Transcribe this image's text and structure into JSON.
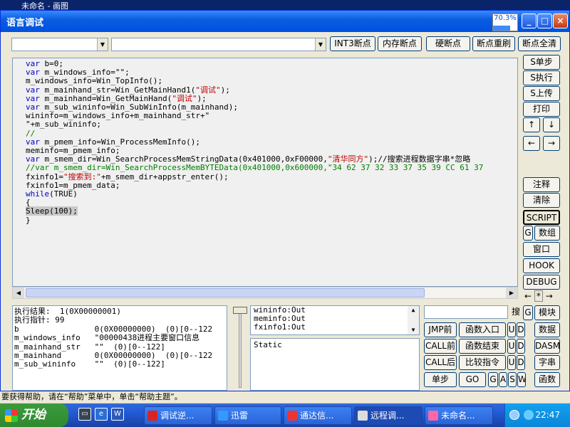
{
  "behind_window": {
    "title": "未命名 - 画图",
    "status_text": "要获得帮助，请在“帮助”菜单中，单击“帮助主题”。"
  },
  "window": {
    "title": "语言调试",
    "progress_text": "70.3%",
    "progress_value": 0.703
  },
  "toolbar": {
    "combo1_value": "",
    "combo2_value": "",
    "int3": "INT3断点",
    "mem": "内存断点",
    "hw": "硬断点",
    "reset": "断点重刷",
    "clear": "断点全清"
  },
  "code": {
    "lines": [
      {
        "t": "var b=0;",
        "k": "var"
      },
      {
        "t": "var m_windows_info=\"\";",
        "k": "var"
      },
      {
        "t": "m_windows_info=Win_TopInfo();"
      },
      {
        "t": "var m_mainhand_str=Win_GetMainHand1(\"调试\");",
        "k": "var"
      },
      {
        "t": "var m_mainhand=Win_GetMainHand(\"调试\");",
        "k": "var"
      },
      {
        "t": "var m_sub_wininfo=Win_SubWinInfo(m_mainhand);",
        "k": "var"
      },
      {
        "t": "wininfo=m_windows_info+m_mainhand_str+\""
      },
      {
        "t": "\"+m_sub_wininfo;"
      },
      {
        "t": "//",
        "c": true
      },
      {
        "t": "var m_pmem_info=Win_ProcessMemInfo();",
        "k": "var"
      },
      {
        "t": "meminfo=m_pmem_info;"
      },
      {
        "t": "var m_smem_dir=Win_SearchProcessMemStringData(0x401000,0xF00000,\"清华同方\");//搜索进程数据字串*忽略",
        "k": "var"
      },
      {
        "t": "//var m_smem_dir=Win_SearchProcessMemBYTEData(0x401000,0x600000,\"34 62 37 32 33 37 35 39 CC 61 37",
        "c": true
      },
      {
        "t": "fxinfo1=\"搜索到:\"+m_smem_dir+appstr_enter();"
      },
      {
        "t": "fxinfo1=m_pmem_data;"
      },
      {
        "t": "while(TRUE)",
        "k": "while"
      },
      {
        "t": "{"
      },
      {
        "t": "Sleep(100);",
        "s": true
      },
      {
        "t": "}"
      }
    ]
  },
  "right_panel": {
    "s_step": "S单步",
    "s_exec": "S执行",
    "s_up": "S上传",
    "print": "打印",
    "up": "↑",
    "down": "↓",
    "left": "←",
    "right": "→",
    "note": "注释",
    "clear": "清除",
    "script": "SCRIPT",
    "g": "G",
    "array": "数组",
    "window": "窗口",
    "hook": "HOOK",
    "debug": "DEBUG",
    "nav_left": "←",
    "nav_star": "*",
    "nav_right": "→"
  },
  "result": {
    "rows": [
      "执行结果:  1(0X00000001)",
      "执行指针: 99",
      "b                0(0X00000000)  (0)[0--122",
      "m_windows_info   \"00000438进程主要窗口信息",
      "m_mainhand_str   \"\"  (0)[0--122]",
      "m_mainhand       0(0X00000000)  (0)[0--122",
      "m_sub_wininfo    \"\"  (0)[0--122]"
    ]
  },
  "watch": {
    "lines": [
      "wininfo:Out",
      "meminfo:Out",
      "fxinfo1:Out"
    ]
  },
  "static_text": "Static",
  "bottom_buttons": {
    "search": "搜",
    "g1": "G",
    "module": "模块",
    "jmp_before": "JMP前",
    "func_entry": "函数入口",
    "u": "U",
    "d": "D",
    "data": "数据",
    "call_before": "CALL前",
    "func_end": "函数结束",
    "dasm": "DASM",
    "call_after": "CALL后",
    "cmp": "比较指令",
    "str": "字串",
    "step": "单步",
    "go": "GO",
    "g2": "G",
    "a": "A",
    "s": "S",
    "w": "W",
    "func": "函数"
  },
  "taskbar": {
    "start": "开始",
    "tasks": [
      "调试逆...",
      "迅雷",
      "通达信...",
      "远程调...",
      "未命名..."
    ],
    "time": "22:47"
  }
}
